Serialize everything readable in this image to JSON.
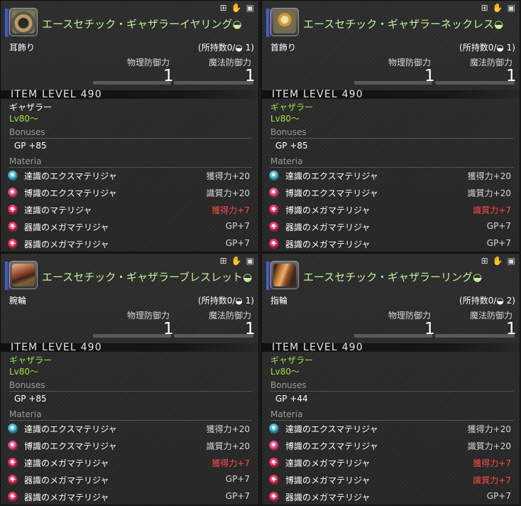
{
  "labels": {
    "physical_defense": "物理防御力",
    "magic_defense": "魔法防御力",
    "bonuses": "Bonuses",
    "materia": "Materia"
  },
  "panels": [
    {
      "name": "エースセチック・ギャザラーイヤリング",
      "hq_mark": "◒",
      "category": "耳飾り",
      "owned": "(所持数0/◒ 1)",
      "phys": "1",
      "mag": "1",
      "item_level": "ITEM LEVEL 490",
      "job": "ギャザラー",
      "job_color": "#ffffff",
      "level": "Lv80～",
      "bonus": "GP +85",
      "icon": "earring-icon",
      "materia": [
        {
          "type": "blue",
          "name": "達識のエクスマテリジャ",
          "value": "獲得力+20",
          "capped": false
        },
        {
          "type": "pink",
          "name": "博識のエクスマテリジャ",
          "value": "識質力+20",
          "capped": false
        },
        {
          "type": "red",
          "name": "達識のマテリジャ",
          "value": "獲得力+7",
          "capped": true
        },
        {
          "type": "red",
          "name": "器識のメガマテリジャ",
          "value": "GP+7",
          "capped": false
        },
        {
          "type": "red",
          "name": "器識のメガマテリジャ",
          "value": "GP+7",
          "capped": false
        }
      ]
    },
    {
      "name": "エースセチック・ギャザラーネックレス",
      "hq_mark": "◒",
      "category": "首飾り",
      "owned": "(所持数0/◒ 1)",
      "phys": "1",
      "mag": "1",
      "item_level": "ITEM LEVEL 490",
      "job": "ギャザラー",
      "job_color": "#9fe24a",
      "level": "Lv80～",
      "bonus": "GP +85",
      "icon": "necklace-icon",
      "materia": [
        {
          "type": "blue",
          "name": "達識のエクスマテリジャ",
          "value": "獲得力+20",
          "capped": false
        },
        {
          "type": "pink",
          "name": "博識のエクスマテリジャ",
          "value": "識質力+20",
          "capped": false
        },
        {
          "type": "red",
          "name": "博識のメガマテリジャ",
          "value": "識質力+7",
          "capped": true
        },
        {
          "type": "red",
          "name": "器識のメガマテリジャ",
          "value": "GP+7",
          "capped": false
        },
        {
          "type": "red",
          "name": "器識のメガマテリジャ",
          "value": "GP+7",
          "capped": false
        }
      ]
    },
    {
      "name": "エースセチック・ギャザラーブレスレット",
      "hq_mark": "◒",
      "category": "腕輪",
      "owned": "(所持数0/◒ 1)",
      "phys": "1",
      "mag": "1",
      "item_level": "ITEM LEVEL 490",
      "job": "ギャザラー",
      "job_color": "#9fe24a",
      "level": "Lv80～",
      "bonus": "GP +85",
      "icon": "bracelet-icon",
      "materia": [
        {
          "type": "blue",
          "name": "達識のエクスマテリジャ",
          "value": "獲得力+20",
          "capped": false
        },
        {
          "type": "pink",
          "name": "博識のエクスマテリジャ",
          "value": "識質力+20",
          "capped": false
        },
        {
          "type": "red",
          "name": "達識のメガマテリジャ",
          "value": "獲得力+7",
          "capped": true
        },
        {
          "type": "red",
          "name": "器識のメガマテリジャ",
          "value": "GP+7",
          "capped": false
        },
        {
          "type": "red",
          "name": "器識のメガマテリジャ",
          "value": "GP+7",
          "capped": false
        }
      ]
    },
    {
      "name": "エースセチック・ギャザラーリング",
      "hq_mark": "◒",
      "category": "指輪",
      "owned": "(所持数0/◒ 2)",
      "phys": "1",
      "mag": "1",
      "item_level": "ITEM LEVEL 490",
      "job": "ギャザラー",
      "job_color": "#9fe24a",
      "level": "Lv80～",
      "bonus": "GP +44",
      "icon": "ring-icon",
      "materia": [
        {
          "type": "blue",
          "name": "達識のエクスマテリジャ",
          "value": "獲得力+20",
          "capped": false
        },
        {
          "type": "pink",
          "name": "博識のエクスマテリジャ",
          "value": "識質力+20",
          "capped": false
        },
        {
          "type": "red",
          "name": "達識のメガマテリジャ",
          "value": "獲得力+7",
          "capped": true
        },
        {
          "type": "red",
          "name": "博識のメガマテリジャ",
          "value": "識質力+7",
          "capped": true
        },
        {
          "type": "red",
          "name": "器識のメガマテリジャ",
          "value": "GP+7",
          "capped": false
        }
      ]
    }
  ],
  "toolbar_icons": [
    "plus-icon",
    "hand-icon",
    "glamour-icon"
  ]
}
